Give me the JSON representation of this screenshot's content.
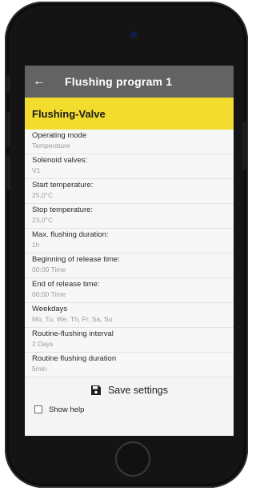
{
  "header": {
    "back_icon": "arrow-left-icon",
    "title": "Flushing program 1"
  },
  "section": {
    "title": "Flushing-Valve"
  },
  "settings": [
    {
      "label": "Operating mode",
      "value": "Temperature"
    },
    {
      "label": "Solenoid valves:",
      "value": "V1"
    },
    {
      "label": "Start temperature:",
      "value": "25,0°C"
    },
    {
      "label": "Stop temperature:",
      "value": "23,0°C"
    },
    {
      "label": "Max. flushing duration:",
      "value": "1h"
    },
    {
      "label": "Beginning of release time:",
      "value": "00:00 Time"
    },
    {
      "label": "End of release time:",
      "value": "00:00 Time"
    },
    {
      "label": "Weekdays",
      "value": "Mo, Tu, We, Th, Fr, Sa, Su"
    },
    {
      "label": "Routine-flushing interval",
      "value": "2 Days"
    },
    {
      "label": "Routine flushing duration",
      "value": "5min"
    }
  ],
  "actions": {
    "save_label": "Save settings",
    "save_icon": "floppy-disk-icon"
  },
  "help": {
    "label": "Show help",
    "checked": false
  },
  "colors": {
    "appbar": "#636363",
    "section": "#f2dc2e",
    "phone": "#141414"
  }
}
